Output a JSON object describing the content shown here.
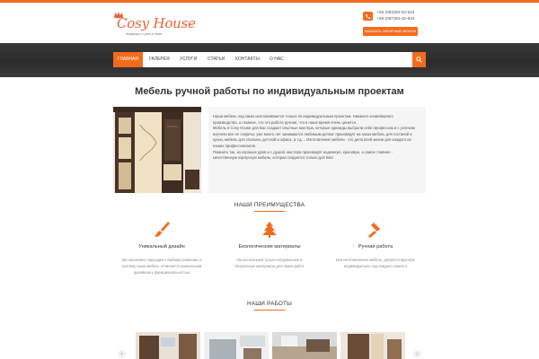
{
  "brand": {
    "name": "Cosy House",
    "tagline": "Комфорт и уют в доме",
    "accent_color": "#f26b1d",
    "icon": "crown-icon"
  },
  "contacts": {
    "phone_icon": "phone-icon",
    "phones": [
      "+38 (093)08-02-924",
      "+38 (097)08-15-924"
    ],
    "callback_label": "ЗАКАЗАТЬ ОБРАТНЫЙ ЗВОНОК"
  },
  "nav": {
    "items": [
      "ГЛАВНАЯ",
      "ГАЛЕРЕЯ",
      "УСЛУГИ",
      "СТАТЬИ",
      "КОНТАКТЫ",
      "О НАС"
    ],
    "active_index": 0,
    "search_icon": "search-icon"
  },
  "page": {
    "title": "Мебель ручной работы по индивидуальным проектам"
  },
  "intro": {
    "lines": [
      "Наша мебель под заказ изготавливается только по индивидуальным проектам. Никакого конвейерного",
      "производства, а главное, что это работа ручная, что в наше время очень ценится.",
      "Мебель в Cosy House для Вас создают опытные мастера, которые однажды выбрали себе профессию и с успехом",
      "изучили все ее секреты; уже много лет занимаются любимым делом: производят на заказ мебель для гостиной и",
      "кухни, мебель для спальни, детской и офиса, и т.д.... Изготовление мебели - это дело всей жизни для каждого из",
      "наших профессионалов.",
      "Помните так, из хороших дров и с душой, мастера производят надежную, красивую, а самое главное -",
      "качественную корпусную мебель, которая создается только для Вас!"
    ]
  },
  "advantages": {
    "title": "НАШИ ПРЕИМУЩЕСТВА",
    "items": [
      {
        "icon": "brush-icon",
        "title": "Уникальный дизайн",
        "desc": [
          "Мы креативно подходим к любому решению, и",
          "поэтому наша мебель отличается уникальным",
          "дизайном и функциональностью"
        ]
      },
      {
        "icon": "tree-icon",
        "title": "Екологические материалы",
        "desc": [
          "Мы используем только натуральные и",
          "безопасные материалы для своих работ"
        ]
      },
      {
        "icon": "hammer-icon",
        "title": "Ручная работа",
        "desc": [
          "Вся изготовленная мебель, делается вручную",
          "индивидуально под каждого клиента"
        ]
      }
    ]
  },
  "works": {
    "title": "НАШИ РАБОТЫ",
    "prev_icon": "chevron-left-icon",
    "next_icon": "chevron-right-icon",
    "items": [
      "work-photo-1",
      "work-photo-2",
      "work-photo-3",
      "work-photo-4"
    ]
  }
}
